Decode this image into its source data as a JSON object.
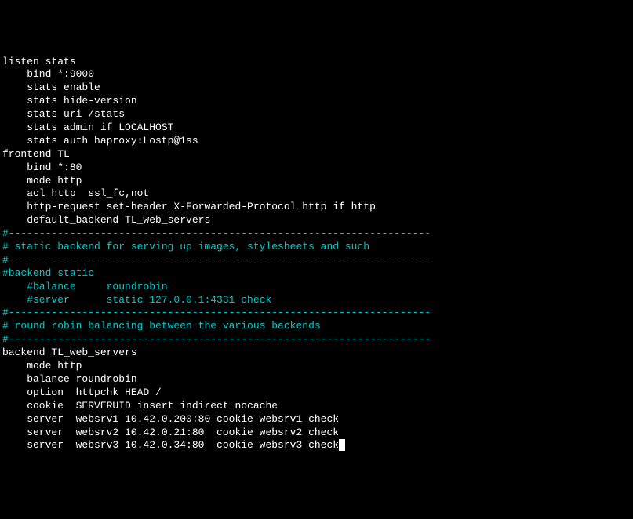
{
  "terminal": {
    "lines": [
      {
        "class": "white",
        "text": "listen stats"
      },
      {
        "class": "white",
        "text": "    bind *:9000"
      },
      {
        "class": "white",
        "text": "    stats enable"
      },
      {
        "class": "white",
        "text": "    stats hide-version"
      },
      {
        "class": "white",
        "text": "    stats uri /stats"
      },
      {
        "class": "white",
        "text": "    stats admin if LOCALHOST"
      },
      {
        "class": "white",
        "text": "    stats auth haproxy:Lostp@1ss"
      },
      {
        "class": "white",
        "text": ""
      },
      {
        "class": "white",
        "text": "frontend TL"
      },
      {
        "class": "white",
        "text": "    bind *:80"
      },
      {
        "class": "white",
        "text": "    mode http"
      },
      {
        "class": "white",
        "text": "    acl http  ssl_fc,not"
      },
      {
        "class": "white",
        "text": "    http-request set-header X-Forwarded-Protocol http if http"
      },
      {
        "class": "white",
        "text": "    default_backend TL_web_servers"
      },
      {
        "class": "white",
        "text": ""
      },
      {
        "class": "cyan",
        "text": "#---------------------------------------------------------------------"
      },
      {
        "class": "cyan",
        "text": "# static backend for serving up images, stylesheets and such"
      },
      {
        "class": "cyan",
        "text": "#---------------------------------------------------------------------"
      },
      {
        "class": "cyan",
        "text": "#backend static"
      },
      {
        "class": "cyan",
        "text": "    #balance     roundrobin"
      },
      {
        "class": "cyan",
        "text": "    #server      static 127.0.0.1:4331 check"
      },
      {
        "class": "white",
        "text": ""
      },
      {
        "class": "cyan",
        "text": "#---------------------------------------------------------------------"
      },
      {
        "class": "cyan",
        "text": "# round robin balancing between the various backends"
      },
      {
        "class": "cyan",
        "text": "#---------------------------------------------------------------------"
      },
      {
        "class": "white",
        "text": "backend TL_web_servers"
      },
      {
        "class": "white",
        "text": "    mode http"
      },
      {
        "class": "white",
        "text": "    balance roundrobin"
      },
      {
        "class": "white",
        "text": "    option  httpchk HEAD /"
      },
      {
        "class": "white",
        "text": "    cookie  SERVERUID insert indirect nocache"
      },
      {
        "class": "white",
        "text": "    server  websrv1 10.42.0.200:80 cookie websrv1 check"
      },
      {
        "class": "white",
        "text": "    server  websrv2 10.42.0.21:80  cookie websrv2 check"
      },
      {
        "class": "white",
        "text": "    server  websrv3 10.42.0.34:80  cookie websrv3 check",
        "cursor": true
      }
    ]
  }
}
